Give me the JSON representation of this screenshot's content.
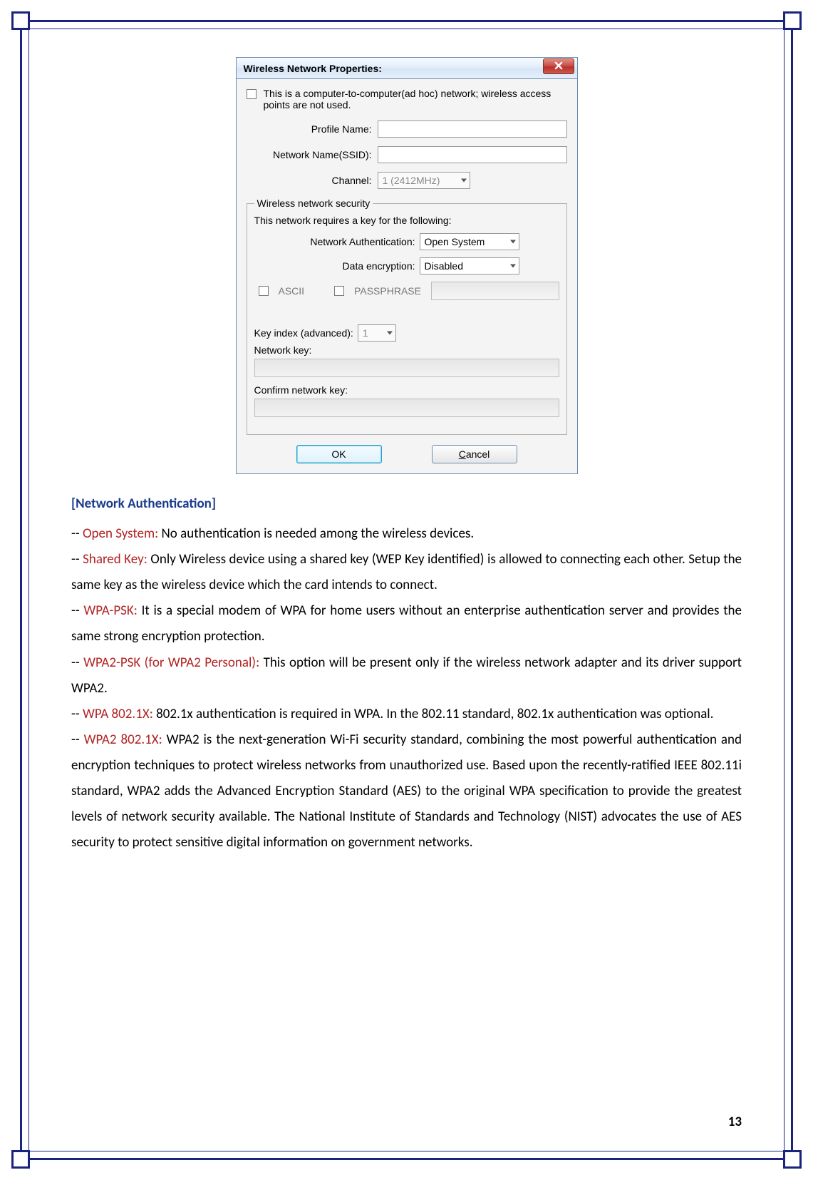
{
  "dialog": {
    "title": "Wireless Network Properties:",
    "adhoc_text": "This is a computer-to-computer(ad hoc) network; wireless access points are not used.",
    "profile_label": "Profile Name:",
    "profile_value": "",
    "ssid_label": "Network Name(SSID):",
    "ssid_value": "",
    "channel_label": "Channel:",
    "channel_value": "1 (2412MHz)",
    "security_legend": "Wireless network security",
    "security_note": "This network requires a key for the following:",
    "auth_label": "Network Authentication:",
    "auth_value": "Open System",
    "enc_label": "Data encryption:",
    "enc_value": "Disabled",
    "ascii_label": "ASCII",
    "passphrase_label": "PASSPHRASE",
    "keyindex_label": "Key index (advanced):",
    "keyindex_value": "1",
    "netkey_label": "Network key:",
    "confirmkey_label": "Confirm network key:",
    "ok_label": "OK",
    "cancel_prefix": "C",
    "cancel_rest": "ancel"
  },
  "article": {
    "heading": "[Network Authentication]",
    "open_term": "Open System:",
    "open_text": " No authentication is needed among the wireless devices.",
    "shared_term": "Shared Key:",
    "shared_text": " Only Wireless device using a shared key (WEP Key identified) is allowed to connecting each other. Setup the same key as the wireless device which the card intends to connect.",
    "wpapsk_term": "WPA-PSK:",
    "wpapsk_text": " It is a special modem of WPA for home users without an enterprise authentication server and provides the same strong encryption protection.",
    "wpa2psk_term": "WPA2-PSK (for WPA2 Personal):",
    "wpa2psk_text": " This option will be present only if the wireless network adapter and its driver support WPA2.",
    "wpa8021x_term": "WPA 802.1X:",
    "wpa8021x_text": " 802.1x authentication is required in WPA. In the 802.11 standard, 802.1x authentication was optional.",
    "wpa28021x_term": "WPA2 802.1X:",
    "wpa28021x_text": " WPA2 is the next-generation Wi-Fi security standard, combining the most powerful authentication and encryption techniques to protect wireless networks from unauthorized use. Based upon the recently-ratified IEEE 802.11i standard, WPA2 adds the Advanced Encryption Standard (AES) to the original WPA specification to provide the greatest levels of network security available. The National Institute of Standards and Technology (NIST) advocates the use of AES security to protect sensitive digital information on government networks."
  },
  "page_number": "13"
}
